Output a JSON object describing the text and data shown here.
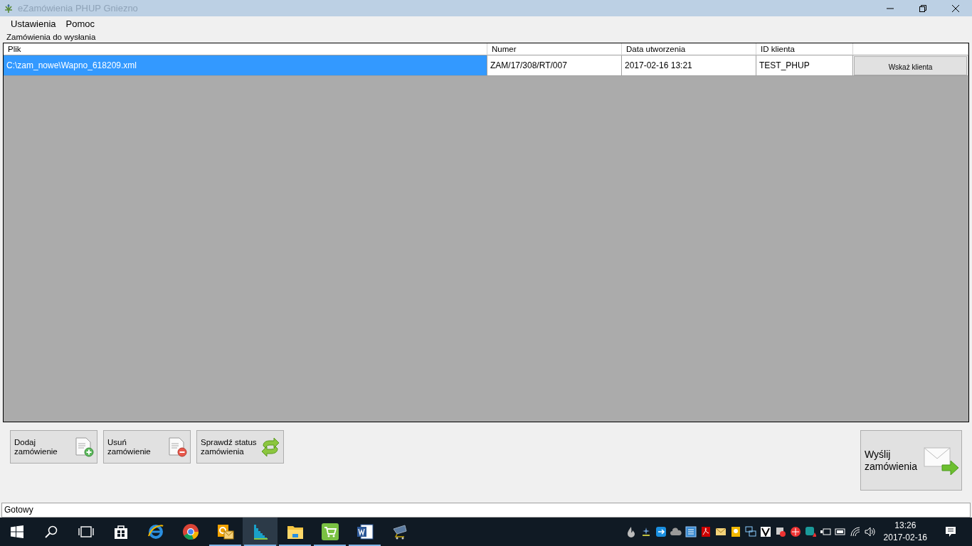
{
  "window": {
    "title": "eZamówienia PHUP Gniezno"
  },
  "menu": [
    "Ustawienia",
    "Pomoc"
  ],
  "group": {
    "title": "Zamówienia do wysłania"
  },
  "table": {
    "columns": [
      "Plik",
      "Numer",
      "Data utworzenia",
      "ID klienta"
    ],
    "rows": [
      {
        "selected": true,
        "cells": [
          "C:\\zam_nowe\\Wapno_618209.xml",
          "ZAM/17/308/RT/007",
          "2017-02-16 13:21",
          "TEST_PHUP"
        ],
        "action": "Wskaż klienta"
      }
    ]
  },
  "buttons": [
    {
      "kind": "add",
      "label": "Dodaj\nzamówienie"
    },
    {
      "kind": "remove",
      "label": "Usuń\nzamówienie"
    },
    {
      "kind": "refresh",
      "label": "Sprawdź status\nzamówienia"
    }
  ],
  "send_button": {
    "label": "Wyślij\nzamówienia"
  },
  "status_bar": "Gotowy",
  "taskbar": {
    "apps": [
      {
        "kind": "ie",
        "running": false,
        "selected": false
      },
      {
        "kind": "chrome",
        "running": false,
        "selected": false
      },
      {
        "kind": "outlook",
        "running": true,
        "selected": false
      },
      {
        "kind": "chart",
        "running": true,
        "selected": true
      },
      {
        "kind": "folder",
        "running": true,
        "selected": false
      },
      {
        "kind": "cart",
        "running": true,
        "selected": false
      },
      {
        "kind": "word",
        "running": true,
        "selected": false
      },
      {
        "kind": "cart2",
        "running": false,
        "selected": false
      }
    ],
    "time": "13:26",
    "date": "2017-02-16"
  }
}
